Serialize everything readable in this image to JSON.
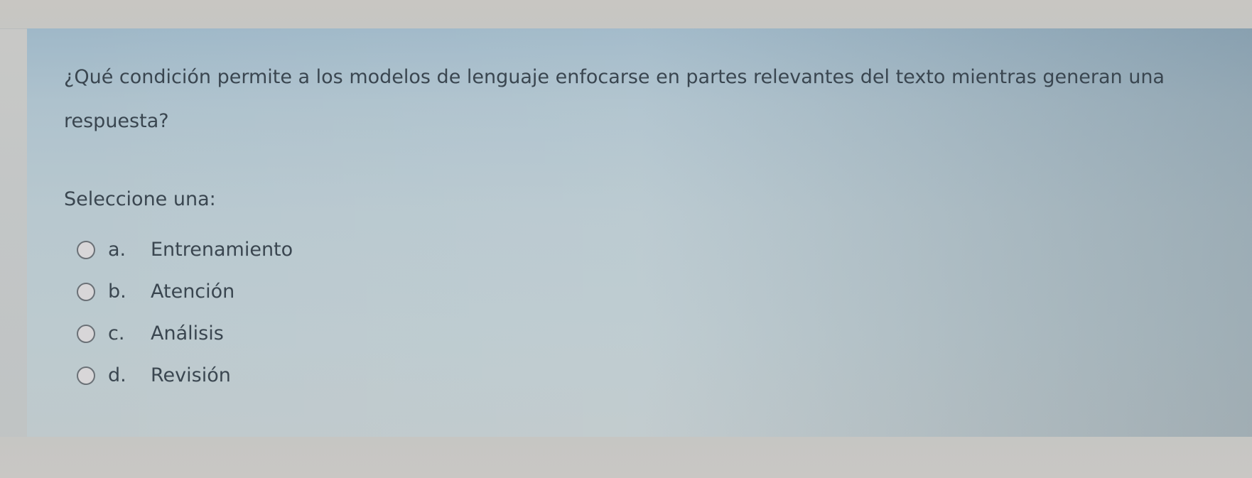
{
  "question": {
    "text": "¿Qué condición permite a los modelos de lenguaje enfocarse en partes relevantes del texto mientras generan una respuesta?",
    "instruction": "Seleccione una:"
  },
  "options": [
    {
      "letter": "a.",
      "text": "Entrenamiento",
      "selected": false
    },
    {
      "letter": "b.",
      "text": "Atención",
      "selected": false
    },
    {
      "letter": "c.",
      "text": "Análisis",
      "selected": false
    },
    {
      "letter": "d.",
      "text": "Revisión",
      "selected": false
    }
  ],
  "colors": {
    "panel": "#b4c6ce",
    "text": "#3a4650",
    "radio_border": "#6b7177"
  }
}
